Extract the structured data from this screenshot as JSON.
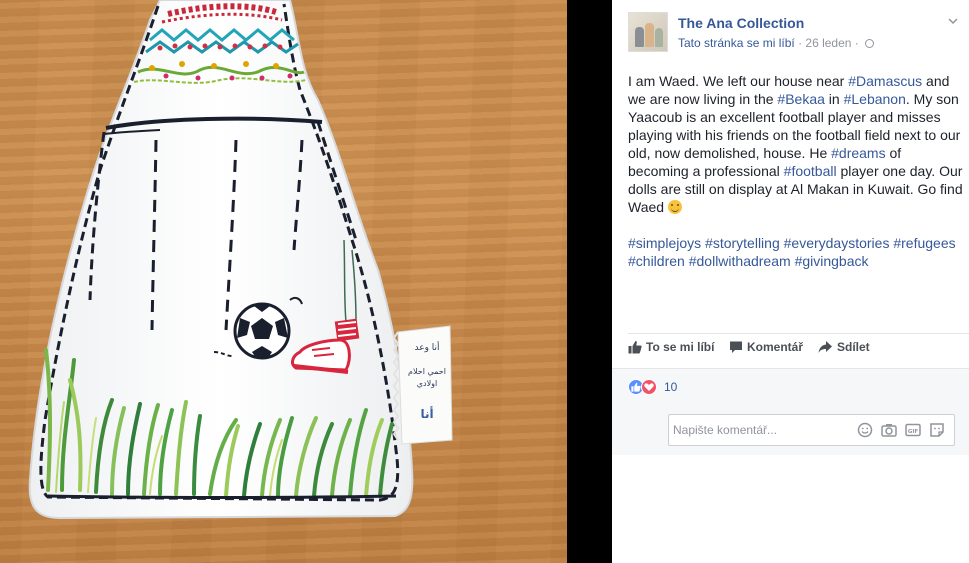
{
  "photo": {
    "tag_lines": [
      "أنا وعد",
      "احمي احلام",
      "اولادي",
      "أنا"
    ]
  },
  "post": {
    "page_name": "The Ana Collection",
    "like_page": "Tato stránka se mi líbí",
    "time": "26 leden",
    "separator": "·",
    "text_part1": "I am Waed. We left our house near ",
    "tag_damascus": "#Damascus",
    "text_part2": " and we are now living in the ",
    "tag_bekaa": "#Bekaa",
    "text_part3": " in ",
    "tag_lebanon": "#Lebanon",
    "text_part4": ". My son Yaacoub is an excellent football player and misses playing with his friends on the football field next to our old, now demolished, house. He ",
    "tag_dreams": "#dreams",
    "text_part5": " of becoming a professional ",
    "tag_football": "#football",
    "text_part6": " player one day. Our dolls are still on display at Al Makan in Kuwait. Go find Waed ",
    "hashtags": [
      "#simplejoys",
      "#storytelling",
      "#everydaystories",
      "#refugees",
      "#children",
      "#dollwithadream",
      "#givingback"
    ]
  },
  "actions": {
    "like": "To se mi líbí",
    "comment": "Komentář",
    "share": "Sdílet"
  },
  "reactions": {
    "count": "10",
    "types": [
      "like",
      "love"
    ]
  },
  "comment_input": {
    "placeholder": "Napište komentář..."
  },
  "icons": [
    "chevron-down-icon",
    "globe-icon",
    "thumbs-up-icon",
    "comment-icon",
    "share-arrow-icon",
    "smiley-emoji-icon",
    "emoji-icon",
    "camera-icon",
    "gif-icon",
    "sticker-icon"
  ],
  "colors": {
    "link": "#365899",
    "text": "#1d2129",
    "muted": "#90949c",
    "like_blue": "#5890ff",
    "love_red": "#f25268"
  }
}
